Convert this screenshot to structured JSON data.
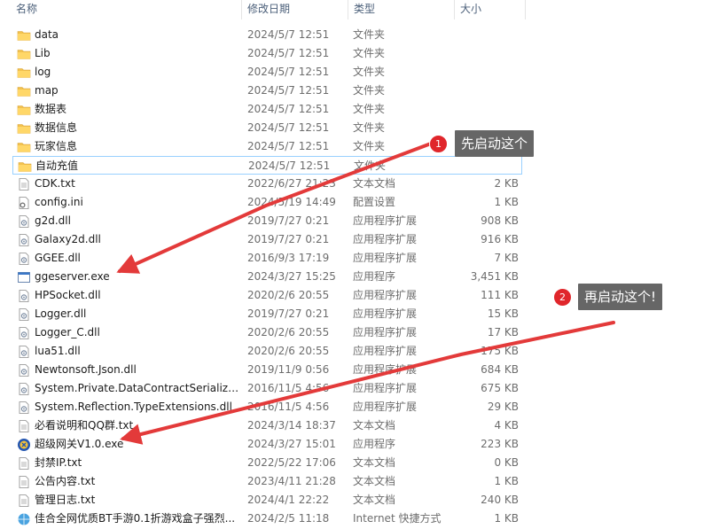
{
  "columns": {
    "name": "名称",
    "date": "修改日期",
    "type": "类型",
    "size": "大小"
  },
  "files": [
    {
      "name": "data",
      "date": "2024/5/7 12:51",
      "type": "文件夹",
      "size": "",
      "icon": "folder-icon"
    },
    {
      "name": "Lib",
      "date": "2024/5/7 12:51",
      "type": "文件夹",
      "size": "",
      "icon": "folder-icon"
    },
    {
      "name": "log",
      "date": "2024/5/7 12:51",
      "type": "文件夹",
      "size": "",
      "icon": "folder-icon"
    },
    {
      "name": "map",
      "date": "2024/5/7 12:51",
      "type": "文件夹",
      "size": "",
      "icon": "folder-icon"
    },
    {
      "name": "数据表",
      "date": "2024/5/7 12:51",
      "type": "文件夹",
      "size": "",
      "icon": "folder-icon"
    },
    {
      "name": "数据信息",
      "date": "2024/5/7 12:51",
      "type": "文件夹",
      "size": "",
      "icon": "folder-icon"
    },
    {
      "name": "玩家信息",
      "date": "2024/5/7 12:51",
      "type": "文件夹",
      "size": "",
      "icon": "folder-icon"
    },
    {
      "name": "自动充值",
      "date": "2024/5/7 12:51",
      "type": "文件夹",
      "size": "",
      "icon": "folder-icon",
      "selected": true
    },
    {
      "name": "CDK.txt",
      "date": "2022/6/27 21:23",
      "type": "文本文档",
      "size": "2 KB",
      "icon": "text-file-icon"
    },
    {
      "name": "config.ini",
      "date": "2024/5/19 14:49",
      "type": "配置设置",
      "size": "1 KB",
      "icon": "config-file-icon"
    },
    {
      "name": "g2d.dll",
      "date": "2019/7/27 0:21",
      "type": "应用程序扩展",
      "size": "908 KB",
      "icon": "dll-file-icon"
    },
    {
      "name": "Galaxy2d.dll",
      "date": "2019/7/27 0:21",
      "type": "应用程序扩展",
      "size": "916 KB",
      "icon": "dll-file-icon"
    },
    {
      "name": "GGEE.dll",
      "date": "2016/9/3 17:19",
      "type": "应用程序扩展",
      "size": "7 KB",
      "icon": "dll-file-icon"
    },
    {
      "name": "ggeserver.exe",
      "date": "2024/3/27 15:25",
      "type": "应用程序",
      "size": "3,451 KB",
      "icon": "exe-window-icon"
    },
    {
      "name": "HPSocket.dll",
      "date": "2020/2/6 20:55",
      "type": "应用程序扩展",
      "size": "111 KB",
      "icon": "dll-file-icon"
    },
    {
      "name": "Logger.dll",
      "date": "2019/7/27 0:21",
      "type": "应用程序扩展",
      "size": "15 KB",
      "icon": "dll-file-icon"
    },
    {
      "name": "Logger_C.dll",
      "date": "2020/2/6 20:55",
      "type": "应用程序扩展",
      "size": "17 KB",
      "icon": "dll-file-icon"
    },
    {
      "name": "lua51.dll",
      "date": "2020/2/6 20:55",
      "type": "应用程序扩展",
      "size": "175 KB",
      "icon": "dll-file-icon"
    },
    {
      "name": "Newtonsoft.Json.dll",
      "date": "2019/11/9 0:56",
      "type": "应用程序扩展",
      "size": "684 KB",
      "icon": "dll-file-icon"
    },
    {
      "name": "System.Private.DataContractSerializati...",
      "date": "2016/11/5 4:56",
      "type": "应用程序扩展",
      "size": "675 KB",
      "icon": "dll-file-icon"
    },
    {
      "name": "System.Reflection.TypeExtensions.dll",
      "date": "2016/11/5 4:56",
      "type": "应用程序扩展",
      "size": "29 KB",
      "icon": "dll-file-icon"
    },
    {
      "name": "必看说明和QQ群.txt",
      "date": "2024/3/14 18:37",
      "type": "文本文档",
      "size": "4 KB",
      "icon": "text-file-icon"
    },
    {
      "name": "超级网关V1.0.exe",
      "date": "2024/3/27 15:01",
      "type": "应用程序",
      "size": "223 KB",
      "icon": "gateway-app-icon"
    },
    {
      "name": "封禁IP.txt",
      "date": "2022/5/22 17:06",
      "type": "文本文档",
      "size": "0 KB",
      "icon": "text-file-icon"
    },
    {
      "name": "公告内容.txt",
      "date": "2023/4/11 21:28",
      "type": "文本文档",
      "size": "1 KB",
      "icon": "text-file-icon"
    },
    {
      "name": "管理日志.txt",
      "date": "2024/4/1 22:22",
      "type": "文本文档",
      "size": "240 KB",
      "icon": "text-file-icon"
    },
    {
      "name": "佳合全网优质BT手游0.1折游戏盒子强烈...",
      "date": "2024/2/5 11:18",
      "type": "Internet 快捷方式",
      "size": "1 KB",
      "icon": "internet-shortcut-icon"
    }
  ],
  "callouts": [
    {
      "number": "1",
      "text": "先启动这个"
    },
    {
      "number": "2",
      "text": "再启动这个!"
    }
  ],
  "colors": {
    "callout_bg": "#666666",
    "badge": "#e0262b",
    "arrow": "#e33a3a",
    "folder": "#f2c14e",
    "selection_border": "#99d1ff"
  }
}
